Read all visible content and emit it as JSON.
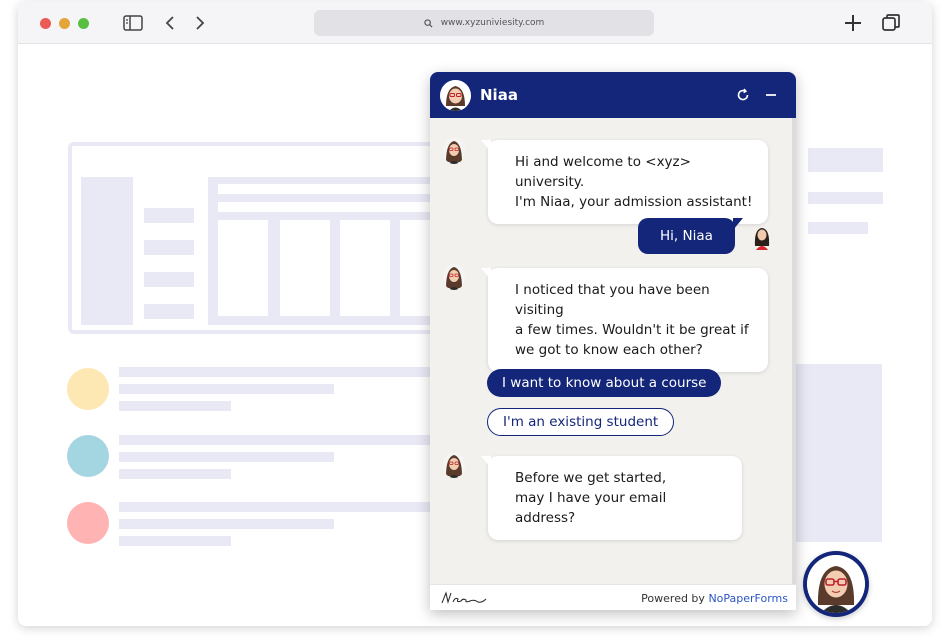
{
  "browser": {
    "url": "www.xyzuniviesity.com",
    "icons": {
      "sidebar": "sidebar-toggle-icon",
      "back": "chevron-left-icon",
      "forward": "chevron-right-icon",
      "new_tab": "plus-icon",
      "tabs": "tabs-overview-icon",
      "search": "search-icon"
    }
  },
  "chat": {
    "assistant_name": "Niaa",
    "colors": {
      "brand": "#13267a",
      "link": "#2b57c4",
      "background": "#f2f1ee"
    },
    "messages": [
      {
        "from": "bot",
        "lines": [
          "Hi and welcome to <xyz> university.",
          "I'm Niaa, your admission assistant!"
        ]
      },
      {
        "from": "user",
        "lines": [
          "Hi, Niaa"
        ]
      },
      {
        "from": "bot",
        "lines": [
          "I noticed that you have been visiting",
          "a few times. Wouldn't it be great if",
          "we got to know each other?"
        ]
      },
      {
        "from": "bot",
        "lines": [
          "Before we get started,",
          "may I have your email address?"
        ]
      }
    ],
    "quick_replies": [
      "I want to know about a course",
      "I'm an existing student"
    ],
    "footer": {
      "powered_prefix": "Powered by ",
      "powered_brand": "NoPaperForms"
    }
  }
}
